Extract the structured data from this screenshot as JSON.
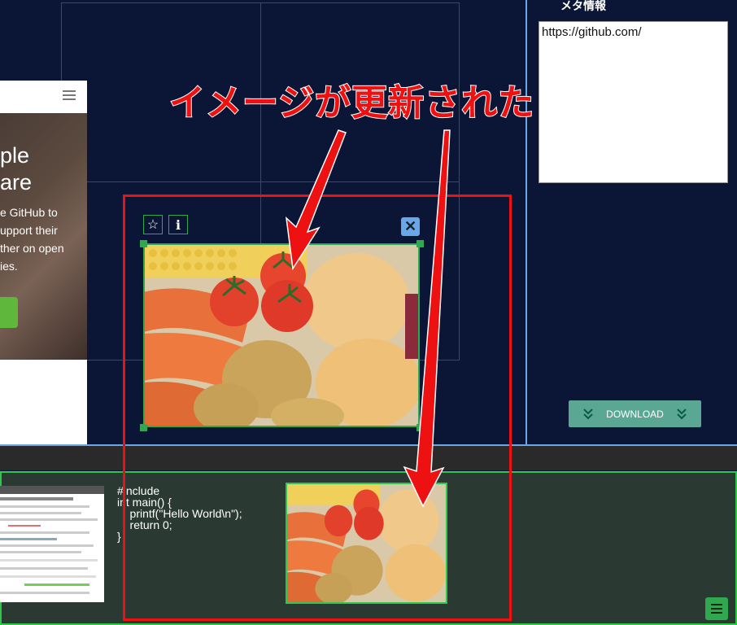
{
  "annotation": {
    "text": "イメージが更新された"
  },
  "web_preview": {
    "hero_lines": [
      "ple",
      "are"
    ],
    "paragraph_lines": [
      "e GitHub to",
      "upport their",
      "ther on open",
      "ies."
    ]
  },
  "image_toolbar": {
    "favorite_icon": "star-icon",
    "info_icon": "info-icon",
    "close_icon": "close-icon",
    "info_label": "i"
  },
  "side_panel": {
    "label": "メタ情報",
    "meta_value": "https://github.com/",
    "download_label": "DOWNLOAD"
  },
  "strip": {
    "code": "#include\nint main() {\n    printf(\"Hello World\\n\");\n    return 0;\n}"
  },
  "colors": {
    "background": "#0b1636",
    "accent_green": "#2fa84f",
    "annotation_red": "#ee1111",
    "panel_border": "#6aa7e8",
    "download_bg": "#5aa894"
  }
}
